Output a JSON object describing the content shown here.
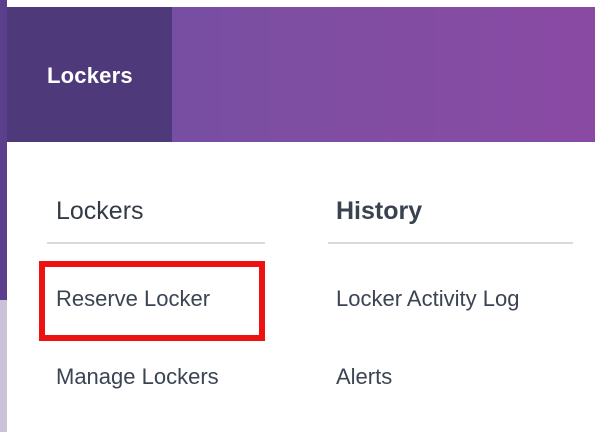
{
  "header": {
    "active_tab_label": "Lockers"
  },
  "menu": {
    "columns": [
      {
        "heading": "Lockers",
        "links": [
          "Reserve Locker",
          "Manage Lockers"
        ]
      },
      {
        "heading": "History",
        "links": [
          "Locker Activity Log",
          "Alerts"
        ]
      }
    ]
  },
  "colors": {
    "header_gradient_start": "#6b4fa3",
    "header_gradient_end": "#8a4aa4",
    "active_tab_bg": "#4e3a7a",
    "highlight": "#ee1111",
    "text": "#3b4452"
  }
}
